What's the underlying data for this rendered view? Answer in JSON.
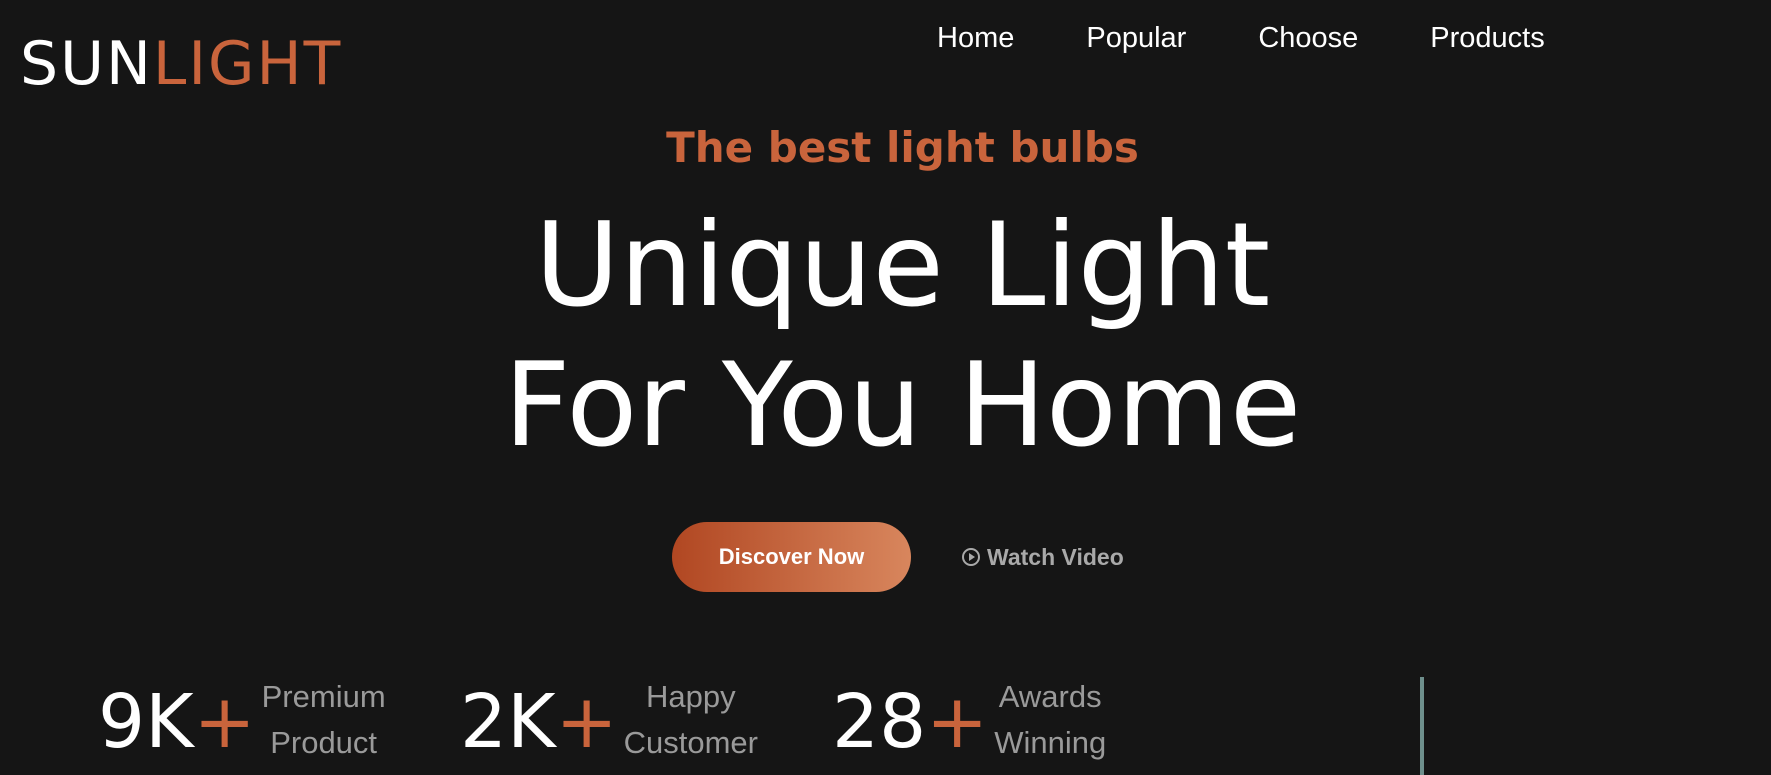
{
  "logo": {
    "part1": "SUN",
    "part2": "LIGHT"
  },
  "nav": {
    "items": [
      {
        "label": "Home"
      },
      {
        "label": "Popular"
      },
      {
        "label": "Choose"
      },
      {
        "label": "Products"
      }
    ]
  },
  "hero": {
    "tagline": "The best light bulbs",
    "headline_line1": "Unique Light",
    "headline_line2": "For You Home",
    "cta_label": "Discover Now",
    "watch_label": "Watch Video"
  },
  "stats": [
    {
      "value": "9K",
      "plus": "+",
      "label_line1": "Premium",
      "label_line2": "Product"
    },
    {
      "value": "2K",
      "plus": "+",
      "label_line1": "Happy",
      "label_line2": "Customer"
    },
    {
      "value": "28",
      "plus": "+",
      "label_line1": "Awards",
      "label_line2": "Winning"
    }
  ],
  "colors": {
    "background": "#151515",
    "accent": "#c9643c",
    "text": "#ffffff",
    "muted": "#9a9a9a"
  },
  "icons": {
    "watch": "play-circle-icon"
  }
}
